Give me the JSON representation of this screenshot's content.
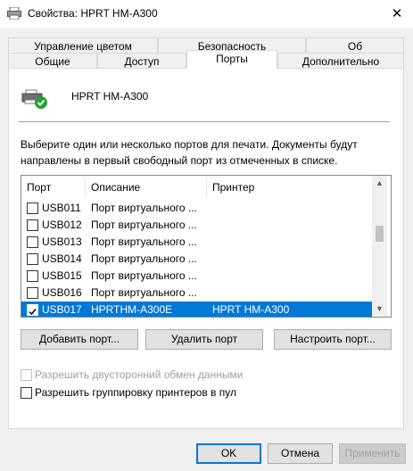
{
  "window": {
    "title": "Свойства: HPRT HM-A300",
    "close_glyph": "✕"
  },
  "tabs_back": [
    "Управление цветом",
    "Безопасность",
    "Об"
  ],
  "tabs_front": [
    "Общие",
    "Доступ",
    "Порты",
    "Дополнительно"
  ],
  "active_tab": "Порты",
  "printer": {
    "name": "HPRT HM-A300"
  },
  "description": "Выберите один или несколько портов для печати. Документы будут направлены в первый свободный порт из отмеченных в списке.",
  "ports_table": {
    "headers": {
      "port": "Порт",
      "description": "Описание",
      "printer": "Принтер"
    },
    "rows": [
      {
        "port": "USB011",
        "description": "Порт виртуального ...",
        "printer": "",
        "checked": false,
        "selected": false
      },
      {
        "port": "USB012",
        "description": "Порт виртуального ...",
        "printer": "",
        "checked": false,
        "selected": false
      },
      {
        "port": "USB013",
        "description": "Порт виртуального ...",
        "printer": "",
        "checked": false,
        "selected": false
      },
      {
        "port": "USB014",
        "description": "Порт виртуального ...",
        "printer": "",
        "checked": false,
        "selected": false
      },
      {
        "port": "USB015",
        "description": "Порт виртуального ...",
        "printer": "",
        "checked": false,
        "selected": false
      },
      {
        "port": "USB016",
        "description": "Порт виртуального ...",
        "printer": "",
        "checked": false,
        "selected": false
      },
      {
        "port": "USB017",
        "description": "HPRTHM-A300E",
        "printer": "HPRT HM-A300",
        "checked": true,
        "selected": true
      }
    ]
  },
  "port_buttons": {
    "add": "Добавить порт...",
    "delete": "Удалить порт",
    "configure": "Настроить порт..."
  },
  "options": {
    "bidirectional": {
      "label": "Разрешить двусторонний обмен данными",
      "checked": false,
      "enabled": false
    },
    "pooling": {
      "label": "Разрешить группировку принтеров в пул",
      "checked": false,
      "enabled": true
    }
  },
  "dialog_buttons": {
    "ok": "OK",
    "cancel": "Отмена",
    "apply": "Применить"
  },
  "colors": {
    "selection": "#0078d7",
    "check_badge": "#21a336"
  }
}
